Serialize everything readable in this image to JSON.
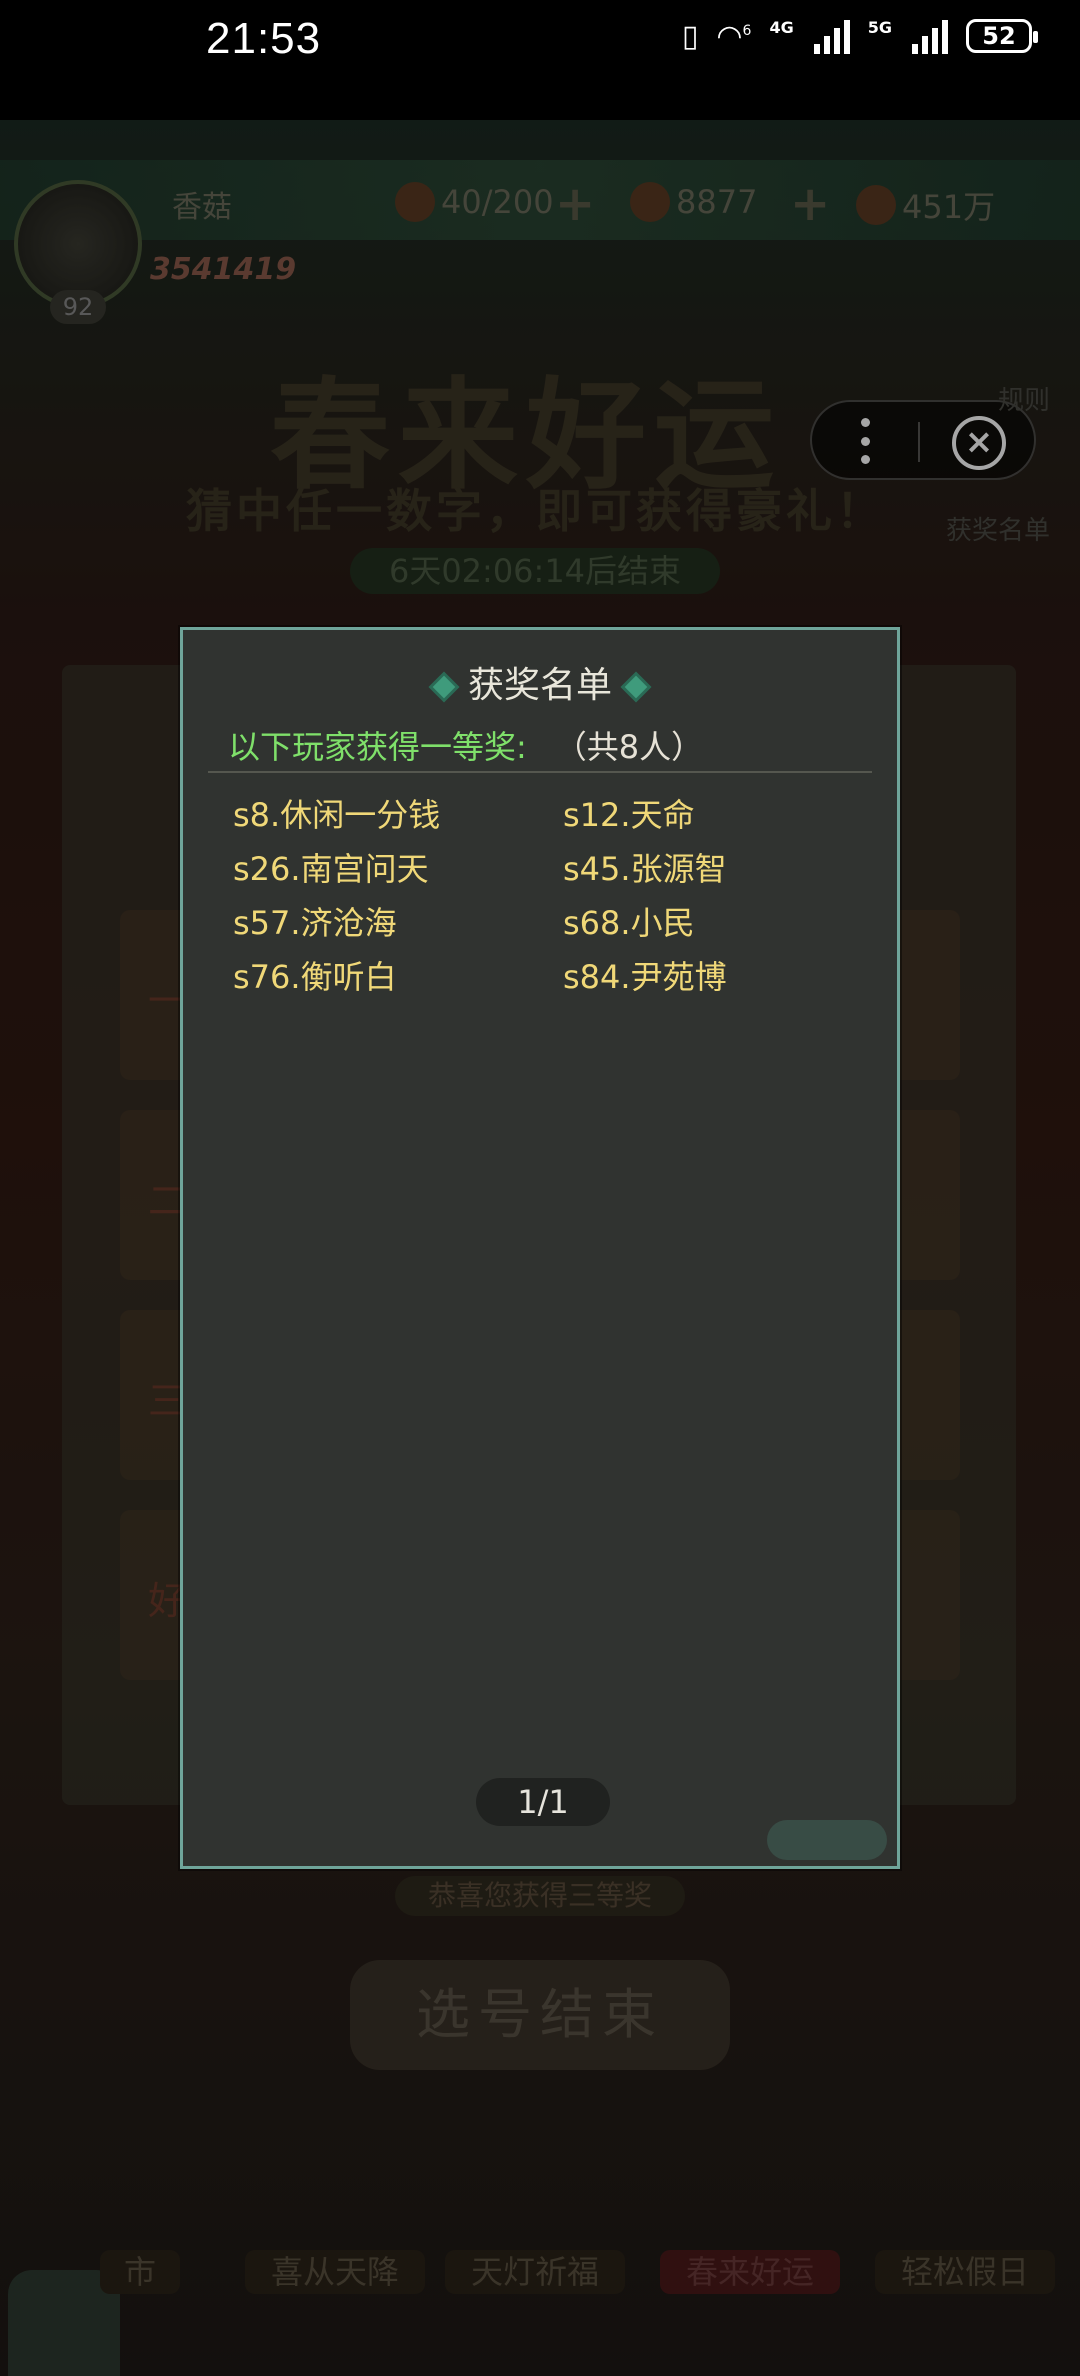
{
  "status_bar": {
    "time": "21:53",
    "network_a": "4G",
    "network_b": "5G",
    "wifi_label": "6",
    "battery": "52"
  },
  "game": {
    "player_name": "香菇",
    "player_level": "92",
    "player_id": "3541419",
    "stamina": "40/200",
    "gems": "8877",
    "gold": "451万",
    "event_title": "春来好运",
    "event_subtitle": "猜中任一数字，即可获得豪礼！",
    "event_timer": "6天02:06:14后结束",
    "side_rules": "规则",
    "side_winners": "获奖名单",
    "rows": [
      "一等奖",
      "二等奖",
      "三等奖",
      "好运奖"
    ],
    "notice": "恭喜您获得三等奖",
    "finish_button": "选号结束",
    "nav": [
      "市",
      "喜从天降",
      "天灯祈福",
      "春来好运",
      "轻松假日"
    ]
  },
  "modal": {
    "title": "获奖名单",
    "subtitle_label": "以下玩家获得一等奖:",
    "subtitle_count": "（共8人）",
    "winners": [
      "s8.休闲一分钱",
      "s12.天命",
      "s26.南宫问天",
      "s45.张源智",
      "s57.济沧海",
      "s68.小民",
      "s76.衡听白",
      "s84.尹苑博"
    ],
    "page": "1/1"
  },
  "colors": {
    "modal_border": "#6fa59a",
    "winner_text": "#f0d878",
    "subtitle_green": "#7fe06a"
  }
}
